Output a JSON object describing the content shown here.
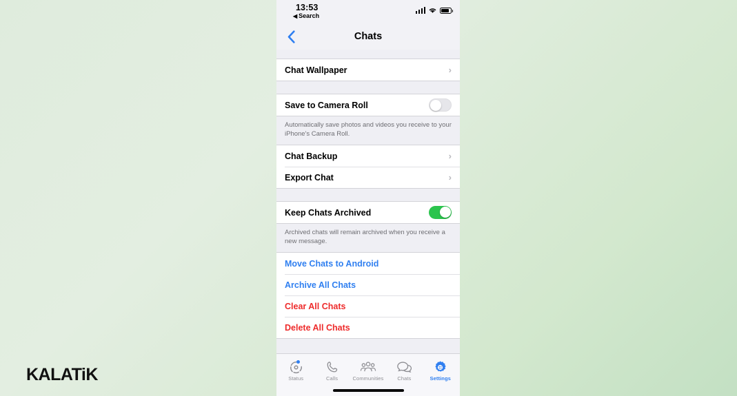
{
  "watermark": "KALATiK",
  "status_bar": {
    "time": "13:53",
    "back_app_label": "Search",
    "back_app_arrow": "◀",
    "icons": [
      "signal-bars-icon",
      "wifi-icon",
      "battery-icon"
    ]
  },
  "nav_bar": {
    "back_icon": "chevron-left-icon",
    "back_glyph": "‹",
    "title": "Chats"
  },
  "sections": [
    {
      "id": "wallpaper",
      "rows": [
        {
          "label": "Chat Wallpaper",
          "type": "disclosure",
          "style": "default",
          "chevron": "›"
        }
      ]
    },
    {
      "id": "camera-roll",
      "rows": [
        {
          "label": "Save to Camera Roll",
          "type": "toggle",
          "style": "default",
          "toggle_state": "off"
        }
      ],
      "caption": "Automatically save photos and videos you receive to your iPhone's Camera Roll."
    },
    {
      "id": "backup-export",
      "rows": [
        {
          "label": "Chat Backup",
          "type": "disclosure",
          "style": "default",
          "chevron": "›"
        },
        {
          "label": "Export Chat",
          "type": "disclosure",
          "style": "default",
          "chevron": "›"
        }
      ]
    },
    {
      "id": "archive",
      "rows": [
        {
          "label": "Keep Chats Archived",
          "type": "toggle",
          "style": "default",
          "toggle_state": "on"
        }
      ],
      "caption": "Archived chats will remain archived when you receive a new message."
    },
    {
      "id": "actions",
      "rows": [
        {
          "label": "Move Chats to Android",
          "type": "action",
          "style": "blue"
        },
        {
          "label": "Archive All Chats",
          "type": "action",
          "style": "blue"
        },
        {
          "label": "Clear All Chats",
          "type": "action",
          "style": "red"
        },
        {
          "label": "Delete All Chats",
          "type": "action",
          "style": "red"
        }
      ]
    }
  ],
  "tab_bar": {
    "items": [
      {
        "label": "Status",
        "icon": "status-ring-icon",
        "active": false,
        "badge": true
      },
      {
        "label": "Calls",
        "icon": "phone-icon",
        "active": false,
        "badge": false
      },
      {
        "label": "Communities",
        "icon": "communities-icon",
        "active": false,
        "badge": false
      },
      {
        "label": "Chats",
        "icon": "chat-bubbles-icon",
        "active": false,
        "badge": false
      },
      {
        "label": "Settings",
        "icon": "gear-icon",
        "active": true,
        "badge": false
      }
    ]
  },
  "colors": {
    "accent_blue": "#2f7ff0",
    "destructive_red": "#ee2b2b",
    "toggle_green": "#2bc44d",
    "grouped_bg": "#efeff4",
    "row_bg": "#ffffff",
    "caption_text": "#6e6e73",
    "background_gradient_start": "#dfecdd",
    "background_gradient_end": "#c3e0c3"
  }
}
